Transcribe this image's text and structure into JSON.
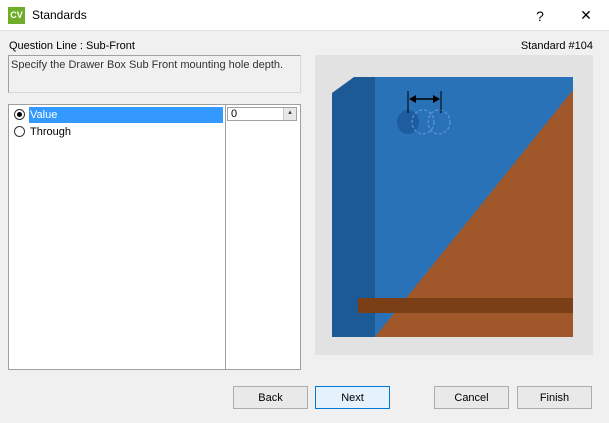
{
  "window": {
    "title": "Standards",
    "app_icon_text": "CV",
    "help_glyph": "?",
    "close_glyph": "✕"
  },
  "header": {
    "question_line": "Question Line : Sub-Front",
    "standard_number": "Standard #104"
  },
  "description": "Specify the Drawer Box Sub Front mounting hole depth.",
  "options": [
    {
      "label": "Value",
      "selected": true
    },
    {
      "label": "Through",
      "selected": false
    }
  ],
  "value_field": {
    "value": "0",
    "spin_glyph": "▴"
  },
  "buttons": {
    "back": "Back",
    "next": "Next",
    "cancel": "Cancel",
    "finish": "Finish"
  },
  "colors": {
    "panel_blue": "#2a72b8",
    "panel_side_blue": "#1c5a96",
    "wood_brown": "#a0582a",
    "shelf_brown": "#7a3f16",
    "selection": "#3399ff",
    "app_icon": "#6fae2b"
  }
}
